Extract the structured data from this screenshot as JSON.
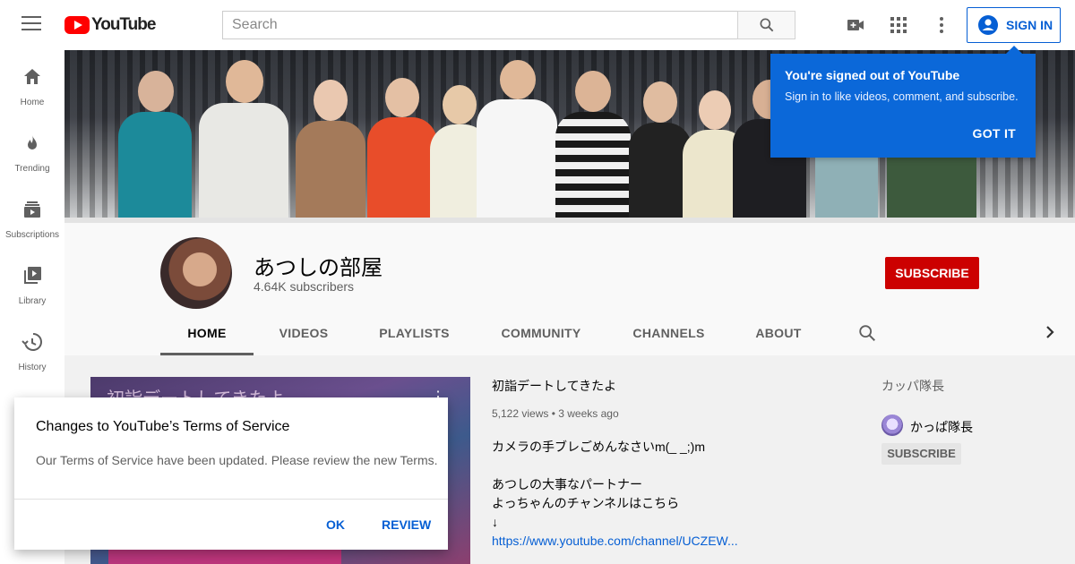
{
  "header": {
    "logo_text": "YouTube",
    "search_placeholder": "Search",
    "signin_label": "SIGN IN"
  },
  "sidebar": {
    "items": [
      {
        "label": "Home",
        "icon": "home-icon"
      },
      {
        "label": "Trending",
        "icon": "flame-icon"
      },
      {
        "label": "Subscriptions",
        "icon": "subscriptions-icon"
      },
      {
        "label": "Library",
        "icon": "library-icon"
      },
      {
        "label": "History",
        "icon": "history-icon"
      }
    ]
  },
  "signout_popup": {
    "title": "You're signed out of YouTube",
    "text": "Sign in to like videos, comment, and subscribe.",
    "button": "GOT IT"
  },
  "channel": {
    "name": "あつしの部屋",
    "subscribers": "4.64K subscribers",
    "subscribe_label": "SUBSCRIBE",
    "tabs": [
      {
        "label": "HOME",
        "active": true
      },
      {
        "label": "VIDEOS",
        "active": false
      },
      {
        "label": "PLAYLISTS",
        "active": false
      },
      {
        "label": "COMMUNITY",
        "active": false
      },
      {
        "label": "CHANNELS",
        "active": false
      },
      {
        "label": "ABOUT",
        "active": false
      }
    ]
  },
  "featured_video": {
    "thumb_text": "初詣デートしてきたよ",
    "title": "初詣デートしてきたよ",
    "views": "5,122 views",
    "age": "3 weeks ago",
    "description": [
      "カメラの手ブレごめんなさいm(_ _;)m",
      "",
      "あつしの大事なパートナー",
      "よっちゃんのチャンネルはこちら",
      "↓"
    ],
    "link": "https://www.youtube.com/channel/UCZEW..."
  },
  "featured_channels": {
    "heading": "カッパ隊長",
    "name": "かっぱ隊長",
    "subscribe_label": "SUBSCRIBE"
  },
  "terms_dialog": {
    "title": "Changes to YouTube’s Terms of Service",
    "text": "Our Terms of Service have been updated. Please review the new Terms.",
    "ok_label": "OK",
    "review_label": "REVIEW"
  },
  "colors": {
    "brand_red": "#ff0000",
    "subscribe_red": "#cc0000",
    "link_blue": "#065fd4",
    "popup_blue": "#0b68d9"
  }
}
